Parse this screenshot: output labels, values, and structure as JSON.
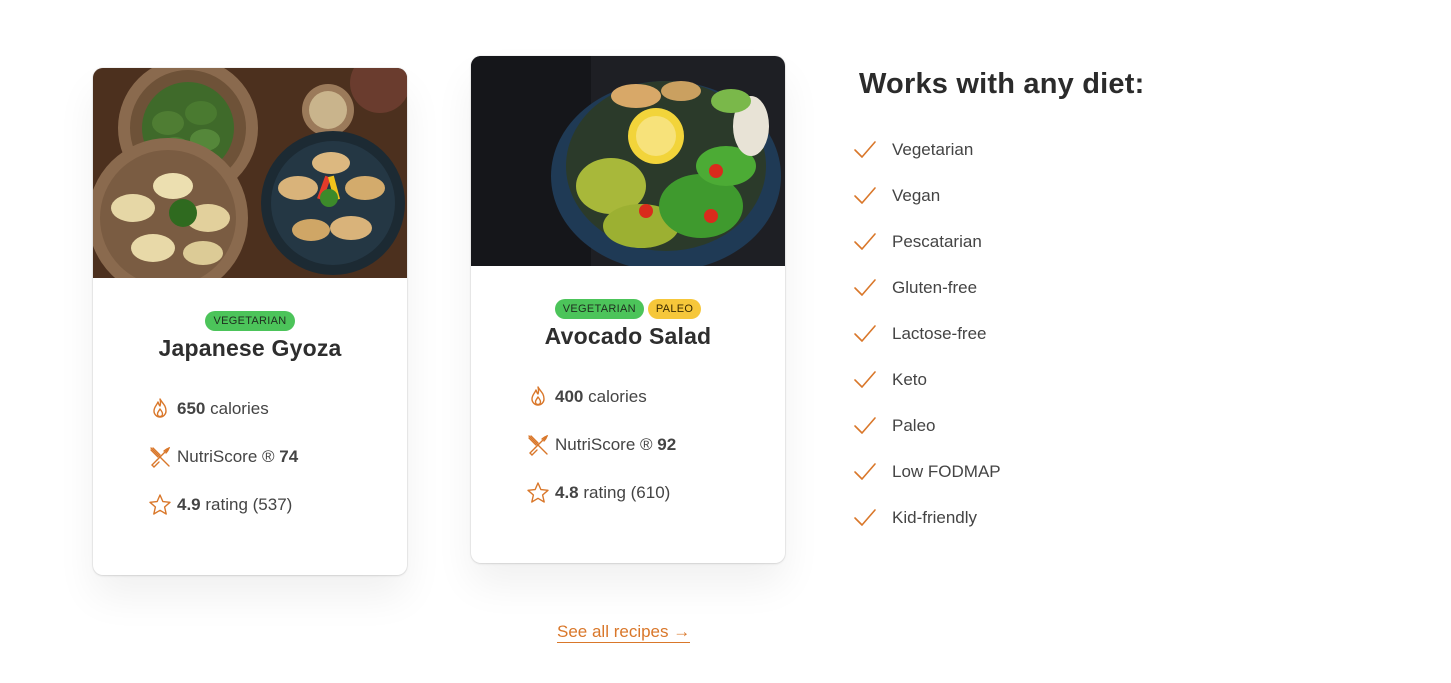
{
  "recipes": [
    {
      "image": "dumplings-photo",
      "tags": [
        {
          "label": "VEGETARIAN",
          "color": "#4cc45a"
        }
      ],
      "title": "Japanese Gyoza",
      "calories_value": "650",
      "calories_label": "calories",
      "nutriscore_label": "NutriScore ®",
      "nutriscore_value": "74",
      "rating_value": "4.9",
      "rating_label": "rating (537)"
    },
    {
      "image": "avocado-salad-photo",
      "tags": [
        {
          "label": "VEGETARIAN",
          "color": "#4cc45a"
        },
        {
          "label": "PALEO",
          "color": "#f6c73a"
        }
      ],
      "title": "Avocado Salad",
      "calories_value": "400",
      "calories_label": "calories",
      "nutriscore_label": "NutriScore ®",
      "nutriscore_value": "92",
      "rating_value": "4.8",
      "rating_label": "rating (610)"
    }
  ],
  "diets": {
    "title": "Works with any diet:",
    "items": [
      "Vegetarian",
      "Vegan",
      "Pescatarian",
      "Gluten-free",
      "Lactose-free",
      "Keto",
      "Paleo",
      "Low FODMAP",
      "Kid-friendly"
    ]
  },
  "see_all": {
    "label": "See all recipes →"
  },
  "colors": {
    "accent": "#d9772a",
    "tag_green": "#4cc45a",
    "tag_yellow": "#f6c73a",
    "text": "#444444"
  },
  "icons": {
    "calories": "flame-icon",
    "nutriscore": "utensils-icon",
    "rating": "star-icon",
    "diet_item": "check-icon"
  }
}
